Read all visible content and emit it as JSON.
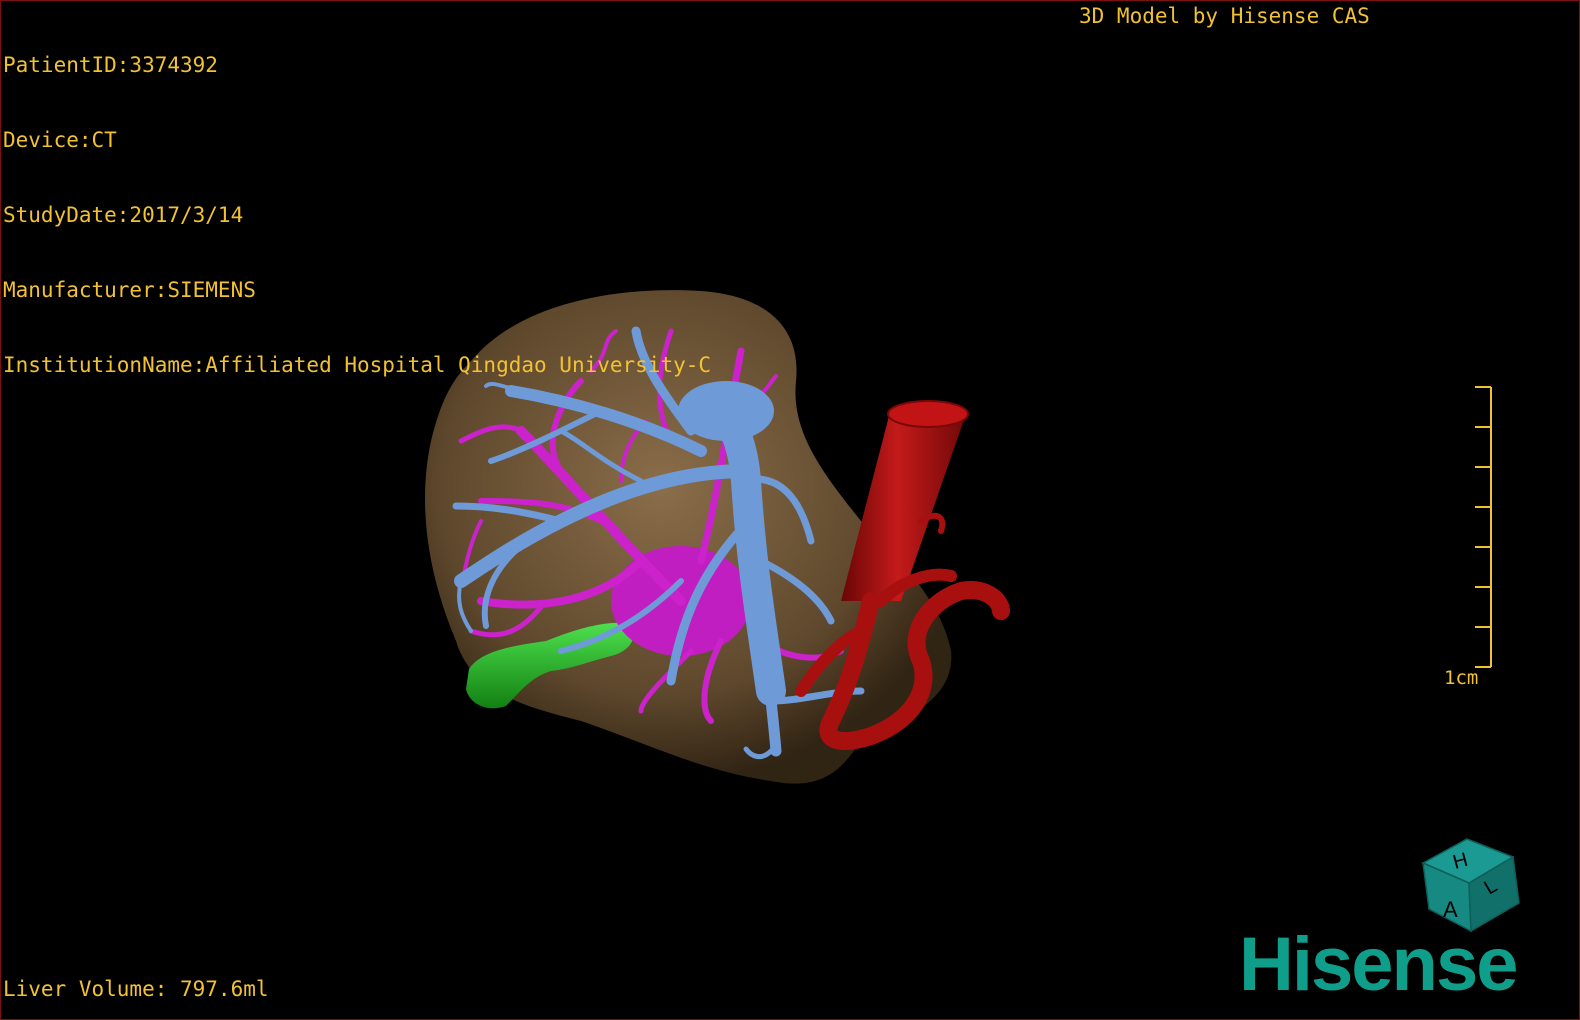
{
  "overlay": {
    "patient_id": "PatientID:3374392",
    "device": "Device:CT",
    "study_date": "StudyDate:2017/3/14",
    "manufacturer": "Manufacturer:SIEMENS",
    "institution": "InstitutionName:Affiliated Hospital Qingdao University-C",
    "title": "3D Model by Hisense CAS",
    "liver_volume": "Liver Volume: 797.6ml"
  },
  "scale_bar": {
    "label": "1cm"
  },
  "orientation_cube": {
    "face_front": "A",
    "face_top": "H",
    "face_side": "L"
  },
  "logo": {
    "text": "Hisense"
  },
  "colors": {
    "overlay_text": "#f2c232",
    "liver": "#8a6a44",
    "portal_vein": "#6f9ad8",
    "hepatic_vein": "#cc22cc",
    "ivc_aorta": "#b01010",
    "gallbladder": "#22bb22",
    "logo": "#0f9e8a"
  }
}
